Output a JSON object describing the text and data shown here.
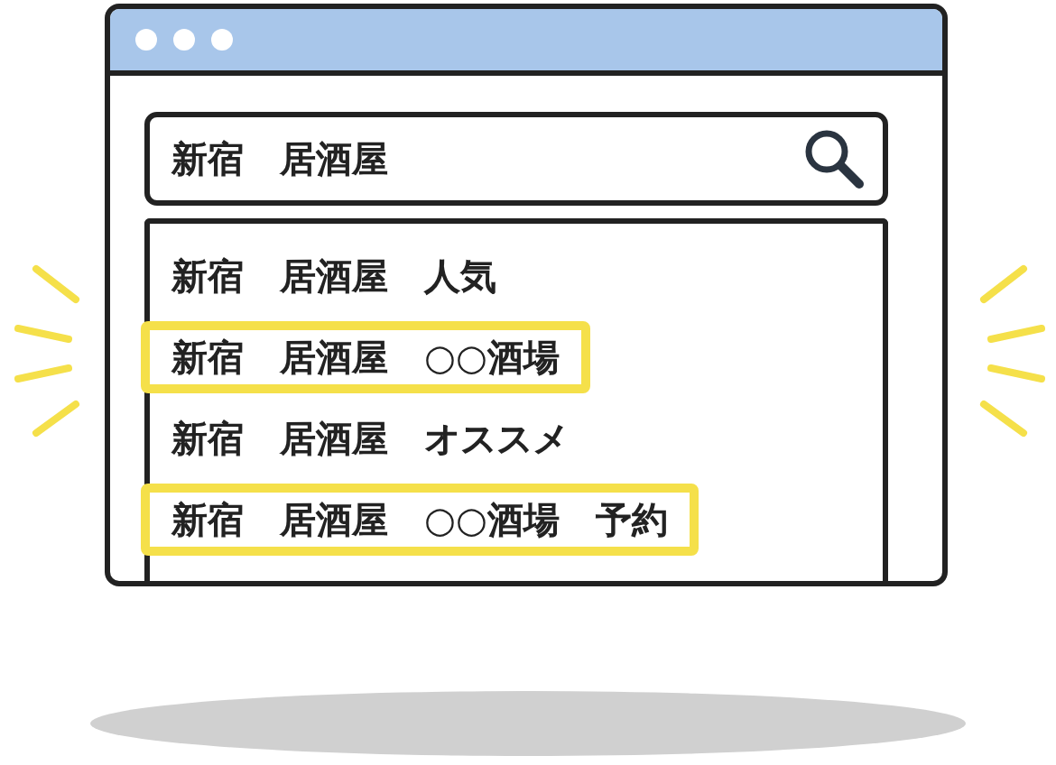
{
  "search": {
    "value": "新宿　居酒屋"
  },
  "suggestions": [
    {
      "text": "新宿　居酒屋　人気",
      "highlighted": false
    },
    {
      "text": "新宿　居酒屋　○○酒場",
      "highlighted": true
    },
    {
      "text": "新宿　居酒屋　オススメ",
      "highlighted": false
    },
    {
      "text": "新宿　居酒屋　○○酒場　予約",
      "highlighted": true
    }
  ]
}
